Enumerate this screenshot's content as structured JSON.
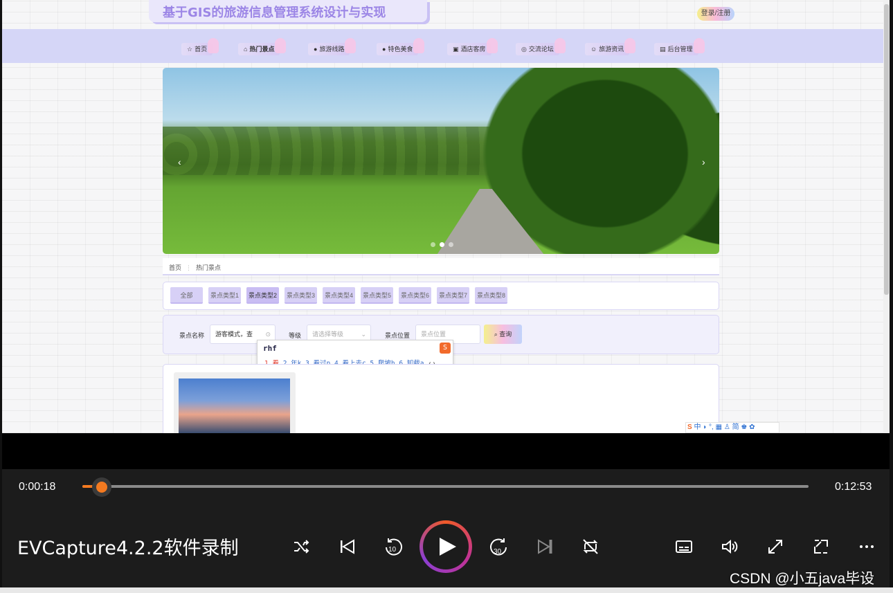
{
  "site": {
    "title": "基于GIS的旅游信息管理系统设计与实现",
    "login_label": "登录/注册"
  },
  "nav": [
    {
      "label": "首页",
      "icon": "star-icon"
    },
    {
      "label": "热门景点",
      "icon": "bag-icon"
    },
    {
      "label": "旅游线路",
      "icon": "info-icon"
    },
    {
      "label": "特色美食",
      "icon": "help-icon"
    },
    {
      "label": "酒店客房",
      "icon": "picture-icon"
    },
    {
      "label": "交流论坛",
      "icon": "globe-icon"
    },
    {
      "label": "旅游资讯",
      "icon": "smile-icon"
    },
    {
      "label": "后台管理",
      "icon": "calendar-icon"
    }
  ],
  "breadcrumb": {
    "home": "首页",
    "current": "热门景点"
  },
  "categories": [
    "全部",
    "景点类型1",
    "景点类型2",
    "景点类型3",
    "景点类型4",
    "景点类型5",
    "景点类型6",
    "景点类型7",
    "景点类型8"
  ],
  "search": {
    "name_label": "景点名称",
    "name_value": "游客模式，查",
    "level_label": "等级",
    "level_placeholder": "请选择等级",
    "location_label": "景点位置",
    "location_placeholder": "景点位置",
    "query_label": "查询"
  },
  "ime_popup": {
    "typed": "rhf",
    "candidates": [
      "1.看",
      "2.年k",
      "3.看过p",
      "4.看上去c",
      "5.爬坡h",
      "6.卸载a"
    ]
  },
  "ime_toolbar": {
    "label": "中 ◗ °, ▦ ♙ 简 ♚ ✿"
  },
  "player": {
    "current_time": "0:00:18",
    "total_time": "0:12:53",
    "progress": 0.023,
    "caption": "EVCapture4.2.2软件录制",
    "accent": "#f47a20"
  },
  "watermark": "CSDN @小五java毕设"
}
